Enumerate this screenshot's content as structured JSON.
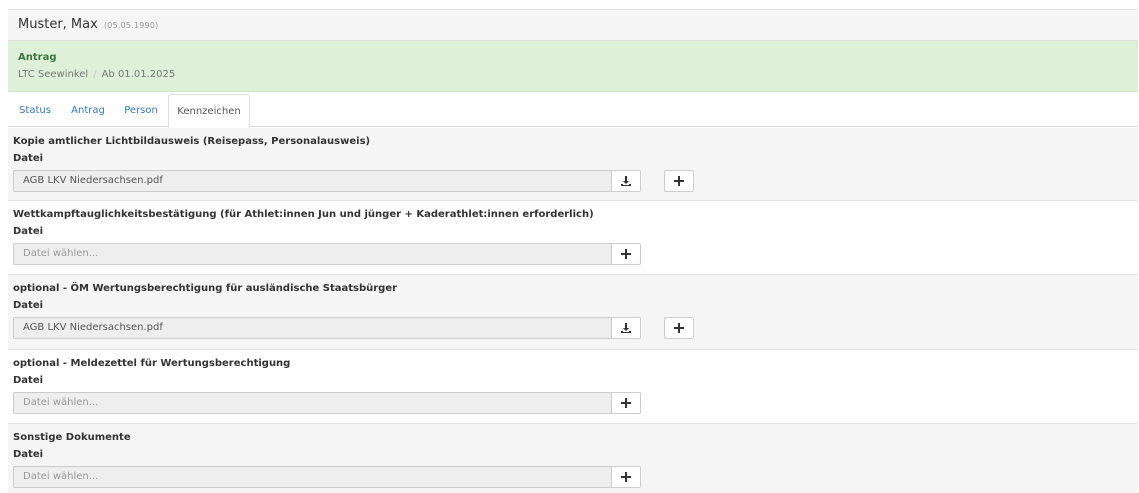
{
  "header": {
    "name": "Muster, Max",
    "dob": "(05.05.1990)"
  },
  "alert": {
    "title": "Antrag",
    "club": "LTC Seewinkel",
    "separator": "/",
    "valid_from": "Ab 01.01.2025"
  },
  "tabs": [
    {
      "label": "Status"
    },
    {
      "label": "Antrag"
    },
    {
      "label": "Person"
    },
    {
      "label": "Kennzeichen",
      "active": true
    }
  ],
  "sections": [
    {
      "title": "Kopie amtlicher Lichtbildausweis (Reisepass, Personalausweis)",
      "field_label": "Datei",
      "file_value": "AGB LKV Niedersachsen.pdf"
    },
    {
      "title": "Wettkampftauglichkeitsbestätigung (für Athlet:innen Jun und jünger + Kaderathlet:innen erforderlich)",
      "field_label": "Datei",
      "placeholder": "Datei wählen..."
    },
    {
      "title": "optional - ÖM Wertungsberechtigung für ausländische Staatsbürger",
      "field_label": "Datei",
      "file_value": "AGB LKV Niedersachsen.pdf"
    },
    {
      "title": "optional - Meldezettel für Wertungsberechtigung",
      "field_label": "Datei",
      "placeholder": "Datei wählen..."
    },
    {
      "title": "Sonstige Dokumente",
      "field_label": "Datei",
      "placeholder": "Datei wählen..."
    }
  ],
  "icons": {
    "download": "download-icon",
    "add": "plus-icon"
  },
  "colors": {
    "link": "#337ab7",
    "alert_bg": "#dff0d8",
    "alert_title": "#3c763d"
  }
}
